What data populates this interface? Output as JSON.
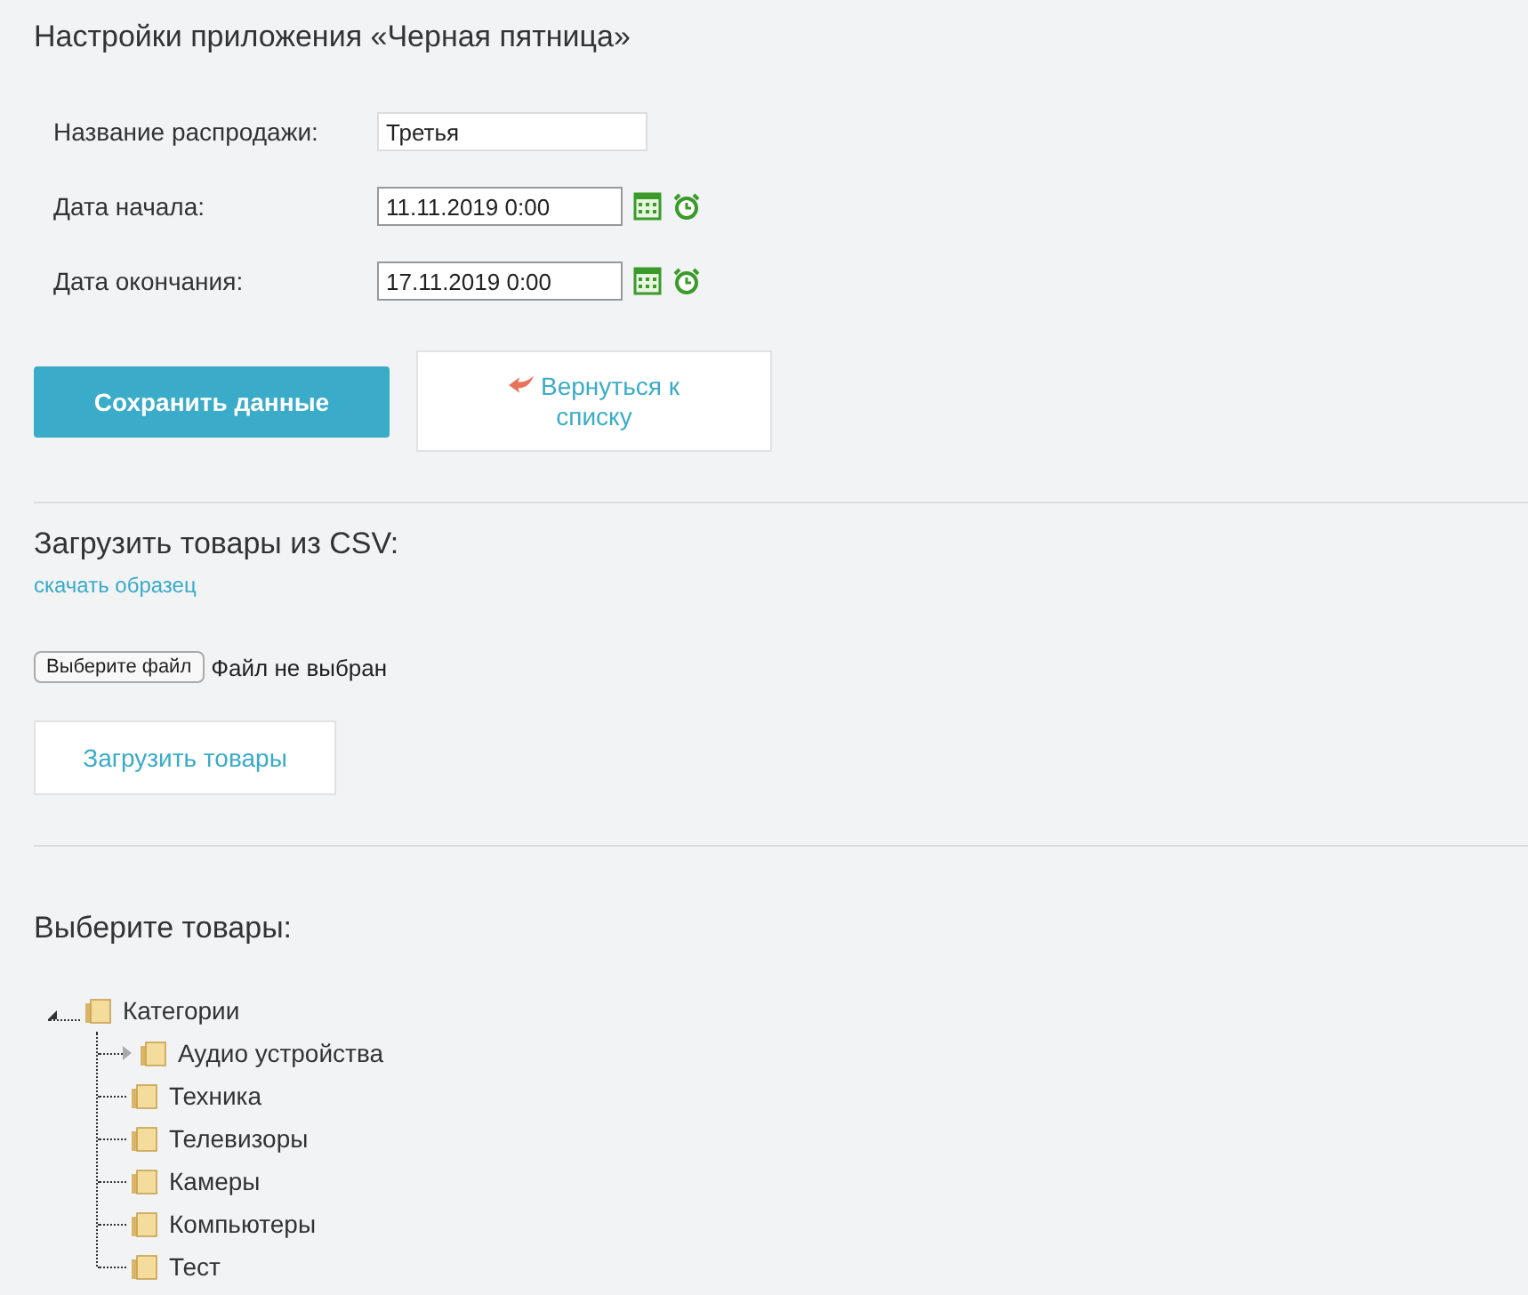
{
  "title": "Настройки приложения «Черная пятница»",
  "form": [
    {
      "label": "Название распродажи:",
      "value": "Третья",
      "kind": "text"
    },
    {
      "label": "Дата начала:",
      "value": "11.11.2019 0:00",
      "kind": "datetime"
    },
    {
      "label": "Дата окончания:",
      "value": "17.11.2019 0:00",
      "kind": "datetime"
    }
  ],
  "save_button": "Сохранить данные",
  "back_button": "Вернуться к списку",
  "csv": {
    "heading": "Загрузить товары из CSV:",
    "sample_link": "скачать образец",
    "file_button": "Выберите файл",
    "file_status": "Файл не выбран",
    "upload_button": "Загрузить товары"
  },
  "products": {
    "heading": "Выберите товары:",
    "tree": [
      {
        "label": "Категории",
        "expanded": true,
        "children": [
          {
            "label": "Аудио устройства",
            "expanded": false
          },
          {
            "label": "Техника"
          },
          {
            "label": "Телевизоры"
          },
          {
            "label": "Камеры"
          },
          {
            "label": "Компьютеры"
          },
          {
            "label": "Тест"
          }
        ]
      }
    ]
  }
}
